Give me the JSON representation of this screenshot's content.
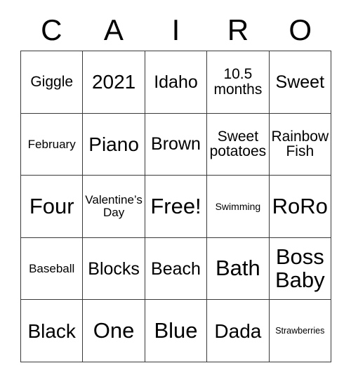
{
  "card": {
    "title": "CAIRO",
    "header_letters": [
      "C",
      "A",
      "I",
      "R",
      "O"
    ],
    "columns": 5,
    "rows": 5,
    "border_color": "#3a3a3a",
    "text_color": "#000000",
    "background_color": "#ffffff",
    "free_space_label": "Free!",
    "free_space_position": "row3-col3"
  },
  "cells": [
    {
      "text": "Giggle",
      "size": "md",
      "row": 1,
      "col": 1
    },
    {
      "text": "2021",
      "size": "xl",
      "row": 1,
      "col": 2
    },
    {
      "text": "Idaho",
      "size": "lg",
      "row": 1,
      "col": 3
    },
    {
      "text": "10.5\nmonths",
      "size": "md",
      "row": 1,
      "col": 4
    },
    {
      "text": "Sweet",
      "size": "lg",
      "row": 1,
      "col": 5
    },
    {
      "text": "February",
      "size": "sm",
      "row": 2,
      "col": 1
    },
    {
      "text": "Piano",
      "size": "xl",
      "row": 2,
      "col": 2
    },
    {
      "text": "Brown",
      "size": "lg",
      "row": 2,
      "col": 3
    },
    {
      "text": "Sweet\npotatoes",
      "size": "md",
      "row": 2,
      "col": 4
    },
    {
      "text": "Rainbow\nFish",
      "size": "md",
      "row": 2,
      "col": 5
    },
    {
      "text": "Four",
      "size": "xxl",
      "row": 3,
      "col": 1
    },
    {
      "text": "Valentine’s\nDay",
      "size": "sm",
      "row": 3,
      "col": 2
    },
    {
      "text": "Free!",
      "size": "xxl",
      "row": 3,
      "col": 3
    },
    {
      "text": "Swimming",
      "size": "xs",
      "row": 3,
      "col": 4
    },
    {
      "text": "RoRo",
      "size": "xxl",
      "row": 3,
      "col": 5
    },
    {
      "text": "Baseball",
      "size": "sm",
      "row": 4,
      "col": 1
    },
    {
      "text": "Blocks",
      "size": "lg",
      "row": 4,
      "col": 2
    },
    {
      "text": "Beach",
      "size": "lg",
      "row": 4,
      "col": 3
    },
    {
      "text": "Bath",
      "size": "xxl",
      "row": 4,
      "col": 4
    },
    {
      "text": "Boss\nBaby",
      "size": "xxl",
      "row": 4,
      "col": 5
    },
    {
      "text": "Black",
      "size": "xl",
      "row": 5,
      "col": 1
    },
    {
      "text": "One",
      "size": "xxl",
      "row": 5,
      "col": 2
    },
    {
      "text": "Blue",
      "size": "xxl",
      "row": 5,
      "col": 3
    },
    {
      "text": "Dada",
      "size": "xl",
      "row": 5,
      "col": 4
    },
    {
      "text": "Strawberries",
      "size": "xxs",
      "row": 5,
      "col": 5
    }
  ]
}
